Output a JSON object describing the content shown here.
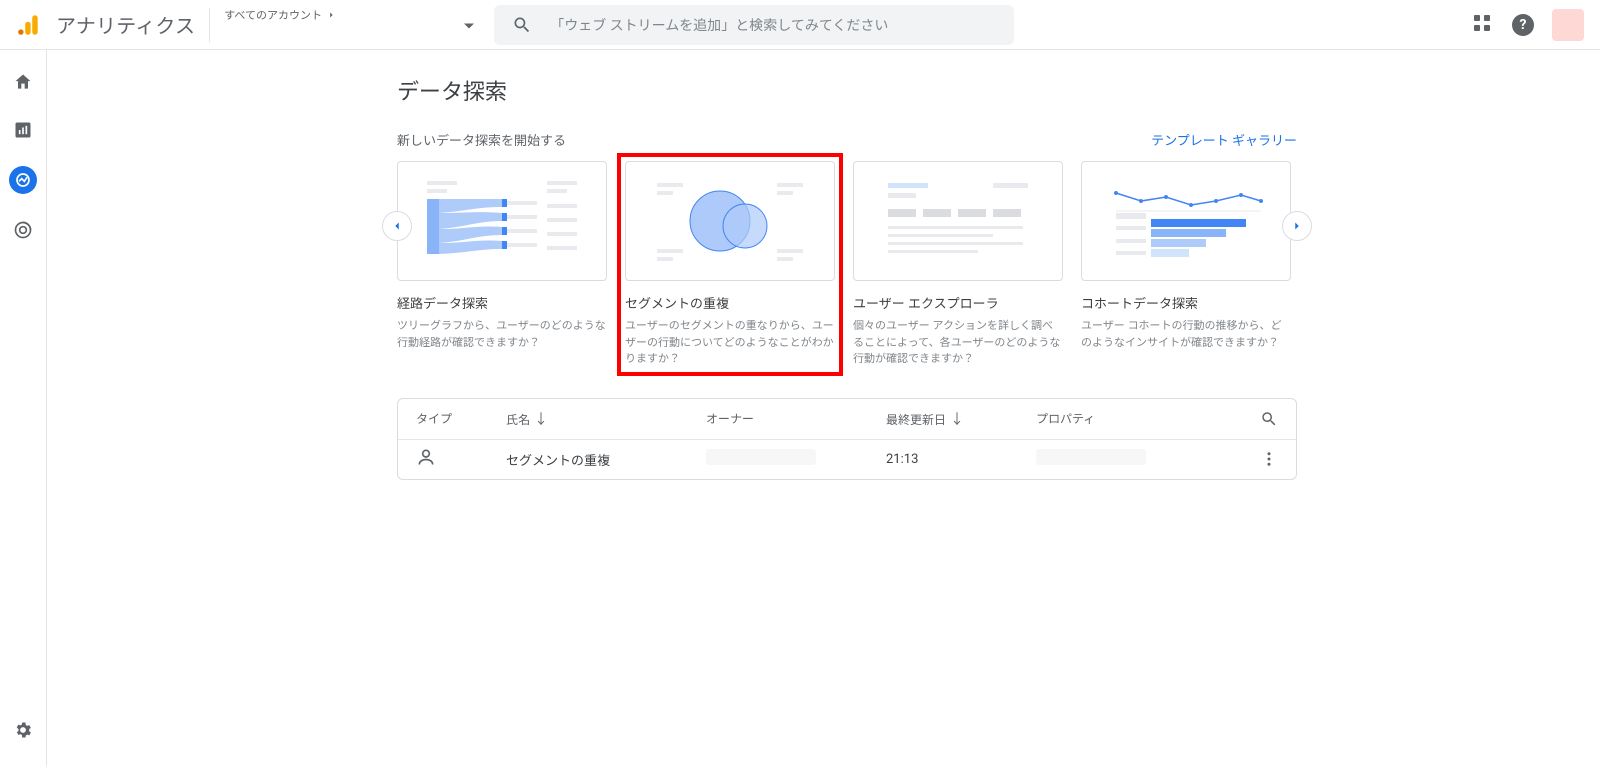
{
  "header": {
    "appTitle": "アナリティクス",
    "accountTop": "すべてのアカウント",
    "searchPlaceholder": "「ウェブ ストリームを追加」と検索してみてください"
  },
  "page": {
    "title": "データ探索",
    "startLabel": "新しいデータ探索を開始する",
    "galleryLink": "テンプレート ギャラリー"
  },
  "cards": [
    {
      "title": "経路データ探索",
      "desc": "ツリーグラフから、ユーザーのどのような行動経路が確認できますか？"
    },
    {
      "title": "セグメントの重複",
      "desc": "ユーザーのセグメントの重なりから、ユーザーの行動についてどのようなことがわかりますか？"
    },
    {
      "title": "ユーザー エクスプローラ",
      "desc": "個々のユーザー アクションを詳しく調べることによって、各ユーザーのどのような行動が確認できますか？"
    },
    {
      "title": "コホートデータ探索",
      "desc": "ユーザー コホートの行動の推移から、どのようなインサイトが確認できますか？"
    }
  ],
  "list": {
    "headers": {
      "type": "タイプ",
      "name": "氏名",
      "owner": "オーナー",
      "updated": "最終更新日",
      "property": "プロパティ"
    },
    "rows": [
      {
        "name": "セグメントの重複",
        "owner": "",
        "updated": "21:13",
        "property": ""
      }
    ]
  }
}
